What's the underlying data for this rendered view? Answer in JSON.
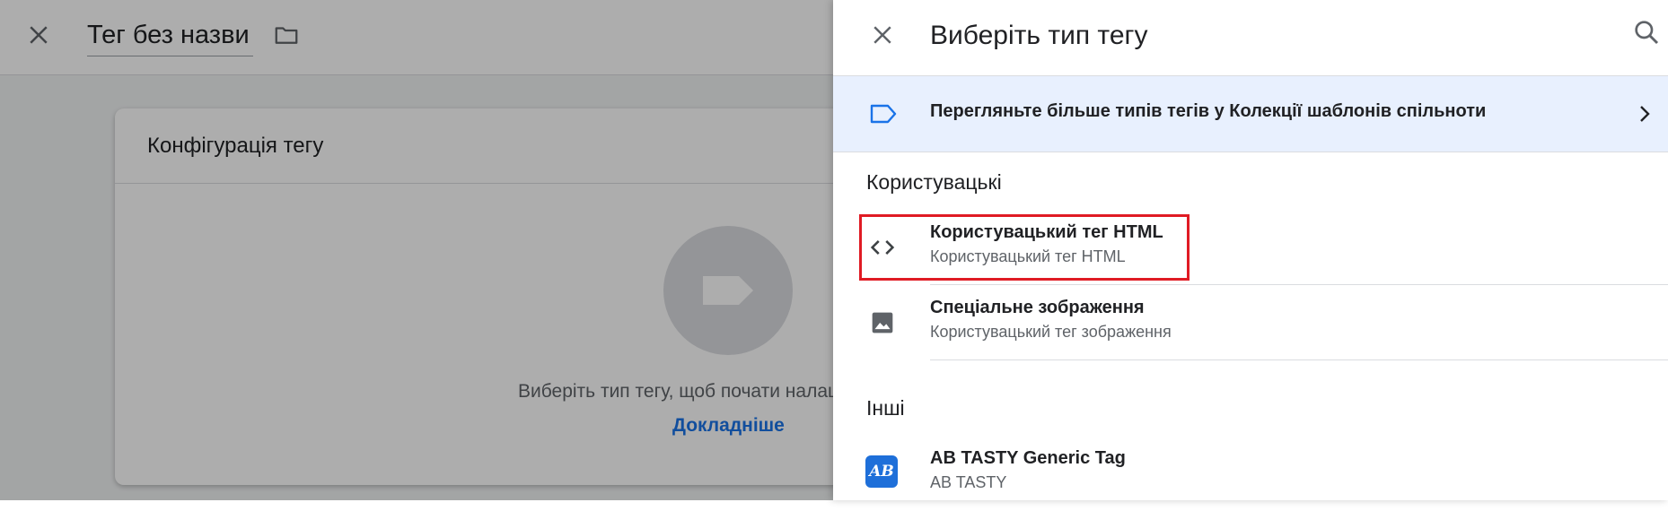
{
  "editor": {
    "tag_title": "Тег без назви",
    "card_title": "Конфігурація тегу",
    "hint_text": "Виберіть тип тегу, щоб почати налаштування",
    "learn_more": "Докладніше"
  },
  "panel": {
    "title": "Виберіть тип тегу",
    "banner_text": "Перегляньте більше типів тегів у Колекції шаблонів спільноти",
    "sections": {
      "custom_label": "Користувацькі",
      "other_label": "Інші"
    },
    "custom_items": [
      {
        "name": "Користувацький тег HTML",
        "subtitle": "Користувацький тег HTML",
        "icon": "code-icon"
      },
      {
        "name": "Спеціальне зображення",
        "subtitle": "Користувацький тег зображення",
        "icon": "image-icon"
      }
    ],
    "other_items": [
      {
        "name": "AB TASTY Generic Tag",
        "subtitle": "AB TASTY",
        "icon": "ab-tasty-logo-icon",
        "logo_text": "AB"
      }
    ]
  },
  "colors": {
    "accent": "#1a73e8",
    "banner_bg": "#e8f0fe",
    "highlight_border": "#e01b24",
    "ab_tasty_blue": "#1e6fd9"
  }
}
